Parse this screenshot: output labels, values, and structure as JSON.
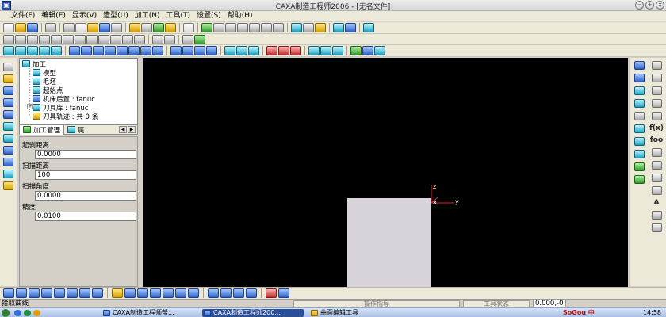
{
  "window": {
    "title": "CAXA制造工程师2006 - [无名文件]",
    "app_icon_glyph": "▣"
  },
  "menu": [
    "文件(F)",
    "编辑(E)",
    "显示(V)",
    "造型(U)",
    "加工(N)",
    "工具(T)",
    "设置(S)",
    "帮助(H)"
  ],
  "tree": {
    "root": "加工",
    "items": [
      {
        "label": "模型",
        "icon": "model-icon"
      },
      {
        "label": "毛坯",
        "icon": "blank-icon"
      },
      {
        "label": "起始点",
        "icon": "start-point-icon"
      },
      {
        "label": "机床后置 : fanuc",
        "icon": "machine-post-icon"
      },
      {
        "label": "刀具库 : fanuc",
        "icon": "tool-library-icon"
      },
      {
        "label": "刀具轨迹 : 共 0 条",
        "icon": "toolpath-folder-icon"
      }
    ],
    "expander_symbol": "+"
  },
  "tabs": {
    "manage": "加工管理",
    "attr": "属",
    "prev_arrow": "◀",
    "next_arrow": "▶"
  },
  "params": [
    {
      "label": "起刹距离",
      "value": "0.0000"
    },
    {
      "label": "扫描距离",
      "value": "100"
    },
    {
      "label": "扫描角度",
      "value": "0.0000"
    },
    {
      "label": "精度",
      "value": "0.0100"
    }
  ],
  "axes": {
    "z": "z",
    "y": "y",
    "origin": "×"
  },
  "right_toolbar": {
    "f_label": "f(x)",
    "foo_label": "foo",
    "a_label": "A"
  },
  "status": {
    "prompt": "拾取曲线",
    "operation": "操作指导",
    "tool_state": "工具状态",
    "coords": "0.000,-0"
  },
  "taskbar": {
    "tasks": [
      {
        "label": "CAXA制造工程师帮...",
        "active": false
      },
      {
        "label": "CAXA制造工程师200...",
        "active": true
      },
      {
        "label": "曲面编辑工具",
        "active": false
      }
    ],
    "ime": "SoGou 中",
    "clock": "14:58"
  },
  "colors": {
    "viewport_bg": "#000000",
    "block": "#d9d4db",
    "axis_red": "#e02020",
    "active_task": "#2b4f97"
  }
}
